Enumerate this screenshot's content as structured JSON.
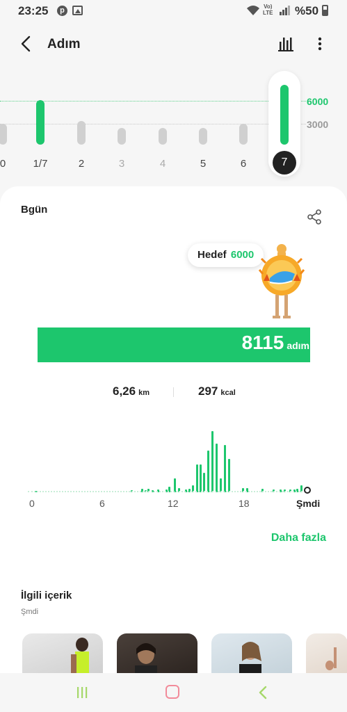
{
  "status": {
    "time": "23:25",
    "battery": "%50",
    "volte": [
      "Vo)",
      "LTE"
    ]
  },
  "appbar": {
    "title": "Adım",
    "icons": [
      "back-arrow-icon",
      "bar-chart-icon",
      "more-vert-icon"
    ]
  },
  "week_chart": {
    "y_labels": {
      "goal": "6000",
      "mid": "3000"
    },
    "days": [
      {
        "label": "0",
        "dim": false,
        "fill": 0.35,
        "green": false
      },
      {
        "label": "1/7",
        "dim": false,
        "fill": 0.75,
        "green": true
      },
      {
        "label": "2",
        "dim": false,
        "fill": 0.4,
        "green": false
      },
      {
        "label": "3",
        "dim": true,
        "fill": 0.2,
        "green": false
      },
      {
        "label": "4",
        "dim": true,
        "fill": 0.2,
        "green": false
      },
      {
        "label": "5",
        "dim": false,
        "fill": 0.25,
        "green": false
      },
      {
        "label": "6",
        "dim": false,
        "fill": 0.35,
        "green": false
      },
      {
        "label": "7",
        "dim": false,
        "fill": 1.0,
        "green": true,
        "selected": true
      }
    ]
  },
  "today": {
    "title": "Bgün",
    "goal_label": "Hedef",
    "goal_value": "6000",
    "steps": "8115",
    "steps_unit": "adım",
    "steps_progress": 1.0,
    "distance": "6,26",
    "distance_unit": "km",
    "calories": "297",
    "calories_unit": "kcal",
    "hourly_axis": [
      "0",
      "6",
      "12",
      "18",
      "Şmdi"
    ],
    "more_link": "Daha fazla"
  },
  "related": {
    "title": "İlgili içerik",
    "subtitle": "Şmdi"
  },
  "colors": {
    "accent": "#1dc66d",
    "inactive_bar": "#d0d0d0",
    "card": "#ffffff",
    "background": "#f6f6f6"
  }
}
